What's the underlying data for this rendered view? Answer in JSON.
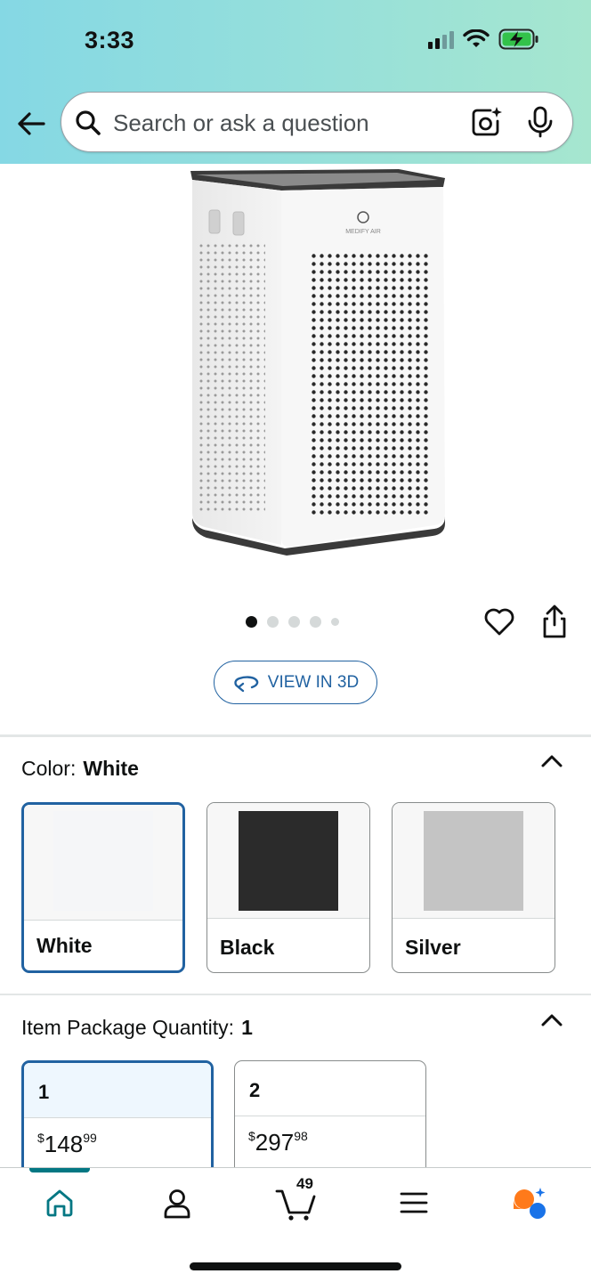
{
  "status_bar": {
    "time": "3:33"
  },
  "search": {
    "placeholder": "Search or ask a question"
  },
  "product": {
    "brand_mark": "MEDIFY AIR",
    "carousel": {
      "total_images": 5,
      "active_index": 0
    },
    "view_3d_label": "VIEW IN 3D"
  },
  "color_section": {
    "label": "Color:",
    "selected_value": "White",
    "options": [
      {
        "name": "White",
        "swatch_color": "#f5f6f8",
        "selected": true
      },
      {
        "name": "Black",
        "swatch_color": "#2b2b2b",
        "selected": false
      },
      {
        "name": "Silver",
        "swatch_color": "#c4c4c4",
        "selected": false
      }
    ]
  },
  "quantity_section": {
    "label": "Item Package Quantity:",
    "selected_value": "1",
    "options": [
      {
        "qty": "1",
        "currency": "$",
        "price_whole": "148",
        "price_fraction": "99",
        "selected": true
      },
      {
        "qty": "2",
        "currency": "$",
        "price_whole": "297",
        "price_fraction": "98",
        "selected": false
      }
    ]
  },
  "bottom_nav": {
    "items": [
      "home-icon",
      "account-icon",
      "cart-icon",
      "menu-icon",
      "rufus-icon"
    ],
    "cart_count": "49",
    "active": "home"
  },
  "colors": {
    "accent_blue": "#2162a1",
    "nav_teal": "#037783",
    "header_gradient_start": "#85d8e4",
    "header_gradient_end": "#a6e6cf",
    "rufus_orange": "#ff7a1a",
    "rufus_blue": "#1a73e8"
  }
}
